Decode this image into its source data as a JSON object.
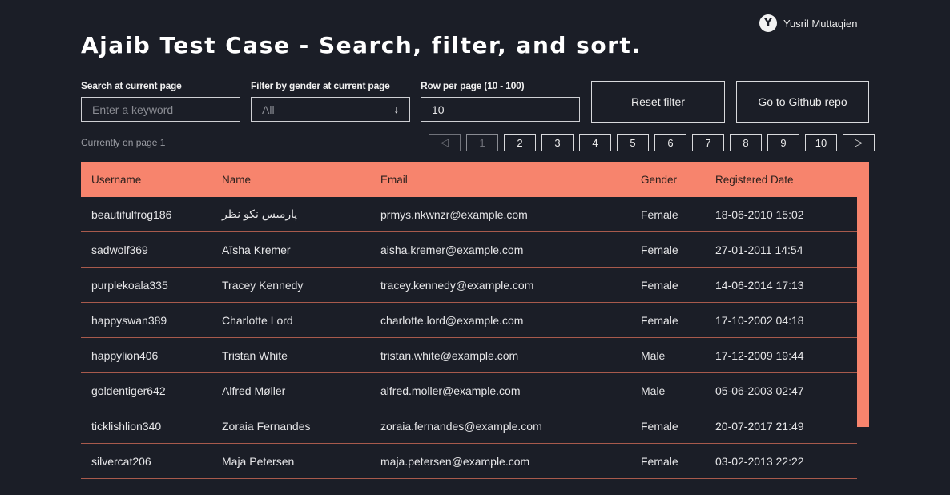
{
  "author": {
    "logo": "Y",
    "name": "Yusril Muttaqien"
  },
  "title": "Ajaib Test Case - Search, filter, and sort.",
  "controls": {
    "search_label": "Search at current page",
    "search_placeholder": "Enter a keyword",
    "gender_label": "Filter by gender at current page",
    "gender_value": "All",
    "rows_label": "Row per page (10 - 100)",
    "rows_value": "10",
    "reset_label": "Reset filter",
    "github_label": "Go to Github repo"
  },
  "page_info": "Currently on page 1",
  "pagination": {
    "prev": "◁",
    "next": "▷",
    "pages": [
      "1",
      "2",
      "3",
      "4",
      "5",
      "6",
      "7",
      "8",
      "9",
      "10"
    ],
    "current": "1"
  },
  "table": {
    "headers": [
      "Username",
      "Name",
      "Email",
      "Gender",
      "Registered Date"
    ],
    "rows": [
      [
        "beautifulfrog186",
        "پارمیس نکو نظر",
        "prmys.nkwnzr@example.com",
        "Female",
        "18-06-2010 15:02"
      ],
      [
        "sadwolf369",
        "Aïsha Kremer",
        "aisha.kremer@example.com",
        "Female",
        "27-01-2011 14:54"
      ],
      [
        "purplekoala335",
        "Tracey Kennedy",
        "tracey.kennedy@example.com",
        "Female",
        "14-06-2014 17:13"
      ],
      [
        "happyswan389",
        "Charlotte Lord",
        "charlotte.lord@example.com",
        "Female",
        "17-10-2002 04:18"
      ],
      [
        "happylion406",
        "Tristan White",
        "tristan.white@example.com",
        "Male",
        "17-12-2009 19:44"
      ],
      [
        "goldentiger642",
        "Alfred Møller",
        "alfred.moller@example.com",
        "Male",
        "05-06-2003 02:47"
      ],
      [
        "ticklishlion340",
        "Zoraia Fernandes",
        "zoraia.fernandes@example.com",
        "Female",
        "20-07-2017 21:49"
      ],
      [
        "silvercat206",
        "Maja Petersen",
        "maja.petersen@example.com",
        "Female",
        "03-02-2013 22:22"
      ]
    ]
  },
  "colors": {
    "background": "#1b1e27",
    "accent": "#f7846d"
  }
}
